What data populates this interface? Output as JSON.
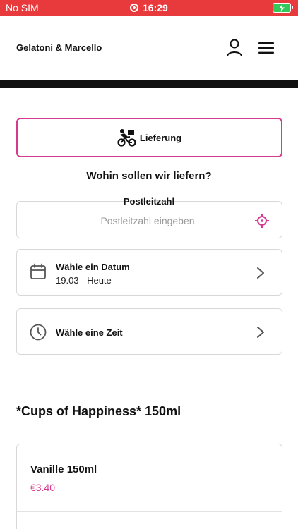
{
  "status_bar": {
    "carrier": "No SIM",
    "time": "16:29"
  },
  "header": {
    "brand": "Gelatoni & Marcello"
  },
  "delivery": {
    "label": "Lieferung"
  },
  "question": "Wohin sollen wir liefern?",
  "postal": {
    "label": "Postleitzahl",
    "placeholder": "Postleitzahl eingeben",
    "value": ""
  },
  "date_picker": {
    "title": "Wähle ein Datum",
    "value": "19.03 - Heute"
  },
  "time_picker": {
    "title": "Wähle eine Zeit"
  },
  "section": {
    "title": "*Cups of Happiness* 150ml"
  },
  "products": [
    {
      "name": "Vanille 150ml",
      "price": "€3.40"
    }
  ],
  "colors": {
    "status_bar": "#e8393c",
    "accent": "#d63a8f",
    "battery": "#34c759"
  }
}
